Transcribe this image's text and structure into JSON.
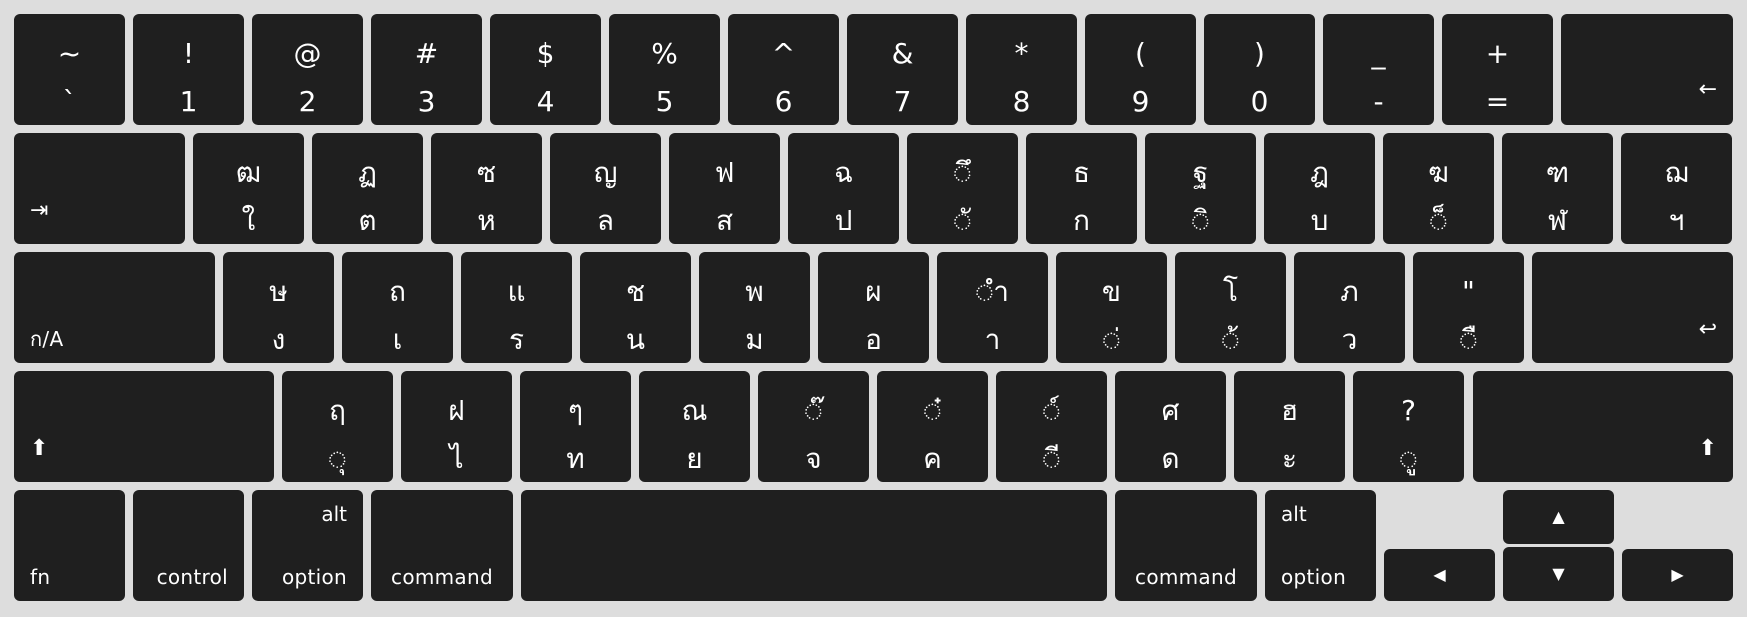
{
  "keyboard": {
    "row1": [
      {
        "shift": "~",
        "base": "`"
      },
      {
        "shift": "!",
        "base": "1"
      },
      {
        "shift": "@",
        "base": "2"
      },
      {
        "shift": "#",
        "base": "3"
      },
      {
        "shift": "$",
        "base": "4"
      },
      {
        "shift": "%",
        "base": "5"
      },
      {
        "shift": "^",
        "base": "6"
      },
      {
        "shift": "&",
        "base": "7"
      },
      {
        "shift": "*",
        "base": "8"
      },
      {
        "shift": "(",
        "base": "9"
      },
      {
        "shift": ")",
        "base": "0"
      },
      {
        "shift": "_",
        "base": "-"
      },
      {
        "shift": "+",
        "base": "="
      }
    ],
    "delete_icon": "←",
    "tab_icon": "⇥",
    "row2": [
      {
        "shift": "ฒ",
        "base": "ใ"
      },
      {
        "shift": "ฏ",
        "base": "ต"
      },
      {
        "shift": "ซ",
        "base": "ห"
      },
      {
        "shift": "ญ",
        "base": "ล"
      },
      {
        "shift": "ฟ",
        "base": "ส"
      },
      {
        "shift": "ฉ",
        "base": "ป"
      },
      {
        "shift": "◌ึ",
        "base": "◌ั"
      },
      {
        "shift": "ธ",
        "base": "ก"
      },
      {
        "shift": "ฐ",
        "base": "◌ิ"
      },
      {
        "shift": "ฎ",
        "base": "บ"
      },
      {
        "shift": "ฆ",
        "base": "◌็"
      },
      {
        "shift": "ฑ",
        "base": "ฬ"
      },
      {
        "shift": "ฌ",
        "base": "ฯ"
      }
    ],
    "caps_label": "ก/A",
    "row3": [
      {
        "shift": "ษ",
        "base": "ง"
      },
      {
        "shift": "ถ",
        "base": "เ"
      },
      {
        "shift": "แ",
        "base": "ร"
      },
      {
        "shift": "ช",
        "base": "น"
      },
      {
        "shift": "พ",
        "base": "ม"
      },
      {
        "shift": "ผ",
        "base": "อ"
      },
      {
        "shift": "◌ำ",
        "base": "า"
      },
      {
        "shift": "ข",
        "base": "◌่"
      },
      {
        "shift": "โ",
        "base": "◌้"
      },
      {
        "shift": "ภ",
        "base": "ว"
      },
      {
        "shift": "\"",
        "base": "◌ื"
      }
    ],
    "return_icon": "↩",
    "shift_icon": "⬆",
    "row4": [
      {
        "shift": "ฤ",
        "base": "◌ุ"
      },
      {
        "shift": "ฝ",
        "base": "ไ"
      },
      {
        "shift": "ๆ",
        "base": "ท"
      },
      {
        "shift": "ณ",
        "base": "ย"
      },
      {
        "shift": "◌๊",
        "base": "จ"
      },
      {
        "shift": "◌๋",
        "base": "ค"
      },
      {
        "shift": "◌์",
        "base": "◌ี"
      },
      {
        "shift": "ศ",
        "base": "ด"
      },
      {
        "shift": "ฮ",
        "base": "ะ"
      },
      {
        "shift": "?",
        "base": "◌ู"
      }
    ],
    "fn_label": "fn",
    "control_label": "control",
    "alt_label": "alt",
    "option_label": "option",
    "command_label": "command",
    "arrows": {
      "up": "▲",
      "left": "◀",
      "down": "▼",
      "right": "▶"
    }
  }
}
